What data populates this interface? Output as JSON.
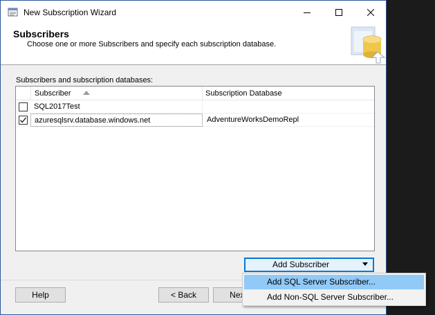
{
  "window": {
    "title": "New Subscription Wizard",
    "controls": {
      "minimize": "minimize-icon",
      "maximize": "maximize-icon",
      "close": "close-icon"
    }
  },
  "header": {
    "title": "Subscribers",
    "subtitle": "Choose one or more Subscribers and specify each subscription database.",
    "art_icon": "database-icon"
  },
  "main": {
    "list_label": "Subscribers and subscription databases:",
    "columns": {
      "subscriber": "Subscriber",
      "database": "Subscription Database",
      "sort": "ascending"
    },
    "rows": [
      {
        "checked": false,
        "subscriber": "SQL2017Test",
        "database": ""
      },
      {
        "checked": true,
        "subscriber": "azuresqlsrv.database.windows.net",
        "database": "AdventureWorksDemoRepl"
      }
    ],
    "add_subscriber": {
      "label": "Add Subscriber"
    }
  },
  "dropdown": {
    "items": [
      {
        "label": "Add SQL Server Subscriber...",
        "highlighted": true
      },
      {
        "label": "Add Non-SQL Server Subscriber...",
        "highlighted": false
      }
    ]
  },
  "footer": {
    "help": "Help",
    "back": "< Back",
    "next": "Next"
  },
  "colors": {
    "accent": "#0078d7",
    "highlight": "#91c9f7",
    "button_hover": "#e5f1fb"
  }
}
